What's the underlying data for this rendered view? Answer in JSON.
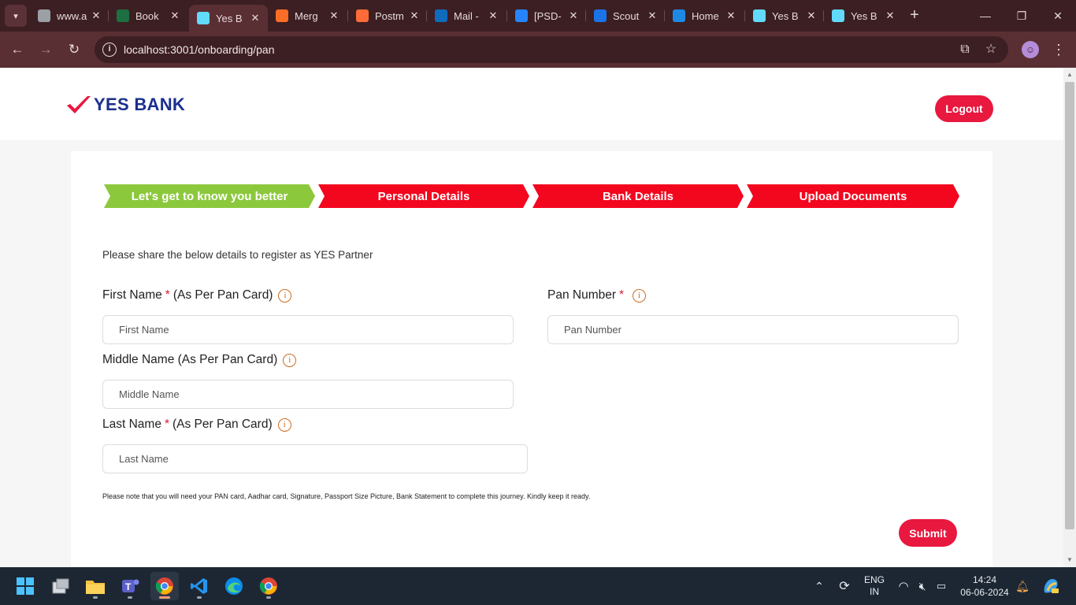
{
  "browser": {
    "tabs": [
      {
        "title": "www.a",
        "favicon": "globe-icon",
        "color": "#9aa0a6",
        "active": false
      },
      {
        "title": "Book",
        "favicon": "excel-icon",
        "color": "#1d6f42",
        "active": false
      },
      {
        "title": "Yes B",
        "favicon": "react-icon",
        "color": "#61dafb",
        "active": true
      },
      {
        "title": "Merg",
        "favicon": "gitlab-icon",
        "color": "#fc6d26",
        "active": false
      },
      {
        "title": "Postm",
        "favicon": "postman-icon",
        "color": "#ff6c37",
        "active": false
      },
      {
        "title": "Mail -",
        "favicon": "outlook-icon",
        "color": "#0f6cbd",
        "active": false
      },
      {
        "title": "[PSD-",
        "favicon": "jira-icon",
        "color": "#2684ff",
        "active": false
      },
      {
        "title": "Scout",
        "favicon": "scout-icon",
        "color": "#1a73e8",
        "active": false
      },
      {
        "title": "Home",
        "favicon": "k-icon",
        "color": "#1e88e5",
        "active": false
      },
      {
        "title": "Yes B",
        "favicon": "react-icon",
        "color": "#61dafb",
        "active": false
      },
      {
        "title": "Yes B",
        "favicon": "react-icon",
        "color": "#61dafb",
        "active": false
      }
    ],
    "url": "localhost:3001/onboarding/pan"
  },
  "header": {
    "brand": "YES BANK",
    "logout_label": "Logout"
  },
  "steps": [
    {
      "label": "Let's get to know you better",
      "status": "current"
    },
    {
      "label": "Personal Details",
      "status": "pending"
    },
    {
      "label": "Bank Details",
      "status": "pending"
    },
    {
      "label": "Upload Documents",
      "status": "pending"
    }
  ],
  "form": {
    "intro": "Please share the below details to register as YES Partner",
    "first_name": {
      "label": "First Name",
      "required_mark": "*",
      "suffix": "(As Per Pan Card)",
      "placeholder": "First Name",
      "value": ""
    },
    "middle_name": {
      "label": "Middle Name (As Per Pan Card)",
      "placeholder": "Middle Name",
      "value": ""
    },
    "last_name": {
      "label": "Last Name",
      "required_mark": "*",
      "suffix": "(As Per Pan Card)",
      "placeholder": "Last Name",
      "value": ""
    },
    "pan_number": {
      "label": "Pan Number",
      "required_mark": "*",
      "placeholder": "Pan Number",
      "value": ""
    },
    "note": "Please note that you will need your PAN card, Aadhar card, Signature, Passport Size Picture, Bank Statement to complete this journey. Kindly keep it ready.",
    "submit_label": "Submit"
  },
  "colors": {
    "brand_red": "#e8183f",
    "step_done": "#8cc83c",
    "step_pending": "#f2071f",
    "brand_blue": "#1b2f8f"
  },
  "taskbar": {
    "lang_top": "ENG",
    "lang_bottom": "IN",
    "time": "14:24",
    "date": "06-06-2024"
  }
}
